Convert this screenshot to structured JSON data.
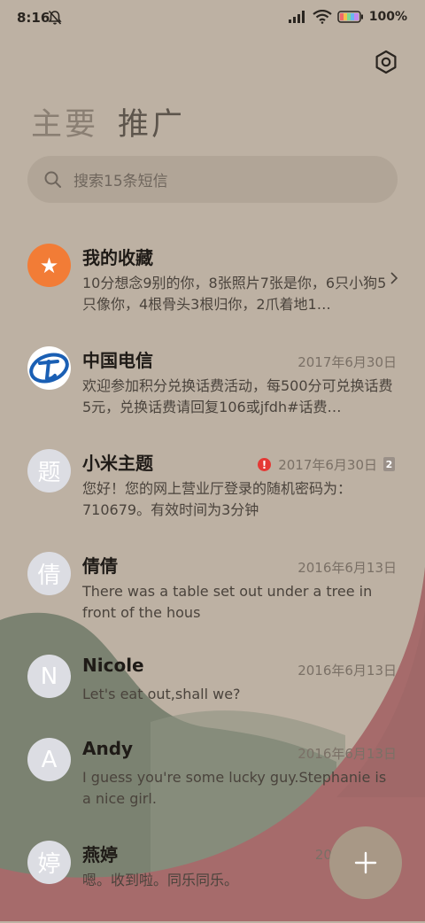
{
  "status_bar": {
    "time": "8:16",
    "battery": "100%"
  },
  "tabs": [
    {
      "label": "主要"
    },
    {
      "label": "推广"
    }
  ],
  "search": {
    "placeholder": "搜索15条短信"
  },
  "conversations": [
    {
      "name": "我的收藏",
      "date": "",
      "preview": "10分想念9别的你，8张照片7张是你，6只小狗5只像你，4根骨头3根归你，2爪着地1…",
      "avatar": "★",
      "avatar_icon": "star-icon"
    },
    {
      "name": "中国电信",
      "date": "2017年6月30日",
      "preview": "欢迎参加积分兑换话费活动，每500分可兑换话费5元，兑换话费请回复106或jfdh#话费…",
      "avatar": "",
      "avatar_icon": "china-telecom-logo-icon"
    },
    {
      "name": "小米主题",
      "date": "2017年6月30日",
      "preview": "您好！您的网上营业厅登录的随机密码为：710679。有效时间为3分钟",
      "avatar": "题",
      "error": "!",
      "count": "2"
    },
    {
      "name": "倩倩",
      "date": "2016年6月13日",
      "preview": "There was a table set out under a tree in front of the hous",
      "avatar": "倩"
    },
    {
      "name": "Nicole",
      "date": "2016年6月13日",
      "preview": "Let's eat out,shall we?",
      "avatar": "N"
    },
    {
      "name": "Andy",
      "date": "2016年6月13日",
      "preview": "I guess you're some lucky guy.Stephanie is a nice girl.",
      "avatar": "A"
    },
    {
      "name": "燕婷",
      "date": "2013",
      "preview": "嗯。收到啦。同乐同乐。",
      "avatar": "婷"
    }
  ],
  "fab": {
    "icon": "plus-icon"
  },
  "colors": {
    "background": "#bdb1a3",
    "wave_green": "#7b8271",
    "wave_red": "#a66b6b",
    "accent_orange": "#f27c36",
    "error_red": "#e53935"
  }
}
